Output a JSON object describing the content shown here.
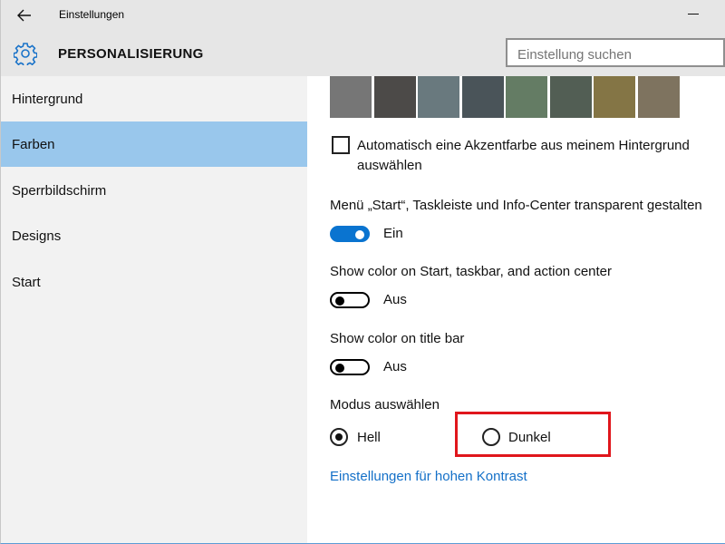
{
  "window": {
    "title": "Einstellungen"
  },
  "header": {
    "title": "PERSONALISIERUNG",
    "search_placeholder": "Einstellung suchen"
  },
  "sidebar": {
    "items": [
      {
        "label": "Hintergrund",
        "active": false
      },
      {
        "label": "Farben",
        "active": true
      },
      {
        "label": "Sperrbildschirm",
        "active": false
      },
      {
        "label": "Designs",
        "active": false
      },
      {
        "label": "Start",
        "active": false
      }
    ]
  },
  "content": {
    "swatch_colors": [
      "#767676",
      "#4c4a48",
      "#69797e",
      "#4a5459",
      "#647c64",
      "#525e54",
      "#847545",
      "#7e735f"
    ],
    "auto_accent": {
      "checked": false,
      "label": "Automatisch eine Akzentfarbe aus meinem Hintergrund auswählen"
    },
    "transparency": {
      "label": "Menü „Start“, Taskleiste und Info-Center transparent gestalten",
      "state": "Ein",
      "on": true
    },
    "color_start": {
      "label": "Show color on Start, taskbar, and action center",
      "state": "Aus",
      "on": false
    },
    "color_titlebar": {
      "label": "Show color on title bar",
      "state": "Aus",
      "on": false
    },
    "mode": {
      "label": "Modus auswählen",
      "options": [
        {
          "label": "Hell",
          "selected": true
        },
        {
          "label": "Dunkel",
          "selected": false
        }
      ]
    },
    "contrast_link": "Einstellungen für hohen Kontrast"
  },
  "colors": {
    "accent": "#0a74d0",
    "link": "#1470c8",
    "sidebar_selected": "#99c7ec",
    "highlight": "#e0161c"
  }
}
